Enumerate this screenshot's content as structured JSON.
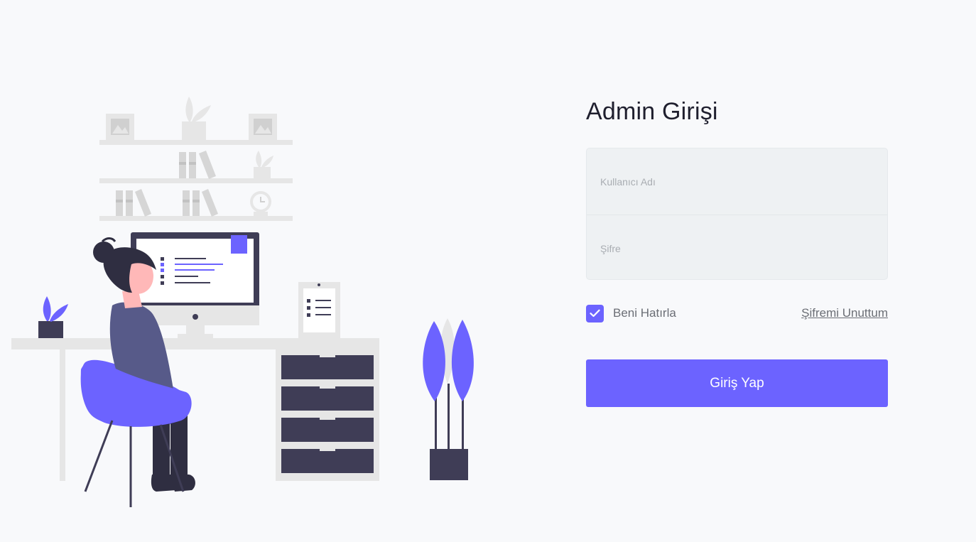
{
  "login": {
    "title": "Admin Girişi",
    "username_placeholder": "Kullanıcı Adı",
    "password_placeholder": "Şifre",
    "remember_label": "Beni Hatırla",
    "remember_checked": true,
    "forgot_label": "Şifremi Unuttum",
    "submit_label": "Giriş Yap"
  },
  "colors": {
    "accent": "#6c63ff",
    "background": "#f8f9fb",
    "field_background": "#eef1f3",
    "dark": "#3f3d56",
    "light_gray": "#e6e6e6"
  },
  "icons": {
    "checkbox": "check-icon",
    "illustration": "woman-at-desk-illustration"
  }
}
